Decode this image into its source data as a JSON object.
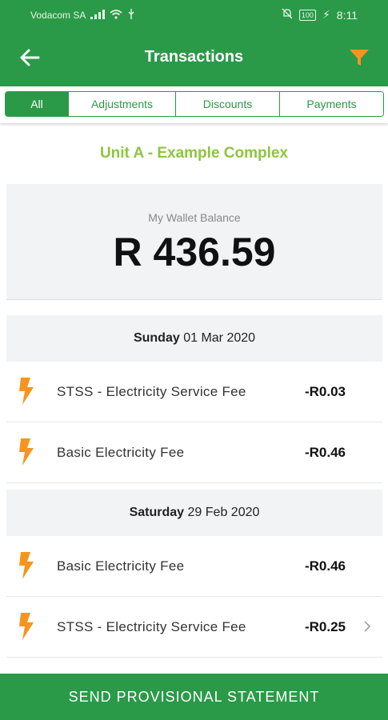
{
  "status_bar": {
    "carrier": "Vodacom SA",
    "battery": "100",
    "time": "8:11"
  },
  "app_bar": {
    "title": "Transactions",
    "back_icon": "arrow-left-icon",
    "filter_icon": "filter-icon"
  },
  "tabs": [
    {
      "label": "All",
      "active": true
    },
    {
      "label": "Adjustments",
      "active": false
    },
    {
      "label": "Discounts",
      "active": false
    },
    {
      "label": "Payments",
      "active": false
    }
  ],
  "complex_name": "Unit A - Example Complex",
  "wallet": {
    "label": "My Wallet Balance",
    "amount": "R 436.59"
  },
  "groups": [
    {
      "day": "Sunday",
      "date": "01 Mar 2020",
      "transactions": [
        {
          "description": "STSS - Electricity Service Fee",
          "amount": "-R0.03",
          "icon": "lightning-icon"
        },
        {
          "description": "Basic Electricity Fee",
          "amount": "-R0.46",
          "icon": "lightning-icon"
        }
      ]
    },
    {
      "day": "Saturday",
      "date": "29 Feb 2020",
      "transactions": [
        {
          "description": "Basic Electricity Fee",
          "amount": "-R0.46",
          "icon": "lightning-icon"
        },
        {
          "description": "STSS - Electricity Service Fee",
          "amount": "-R0.25",
          "icon": "lightning-icon"
        }
      ]
    }
  ],
  "bottom_button": "SEND PROVISIONAL STATEMENT",
  "colors": {
    "primary": "#2a9a48",
    "accent_orange": "#f7941d",
    "complex_green": "#8cc63f"
  }
}
